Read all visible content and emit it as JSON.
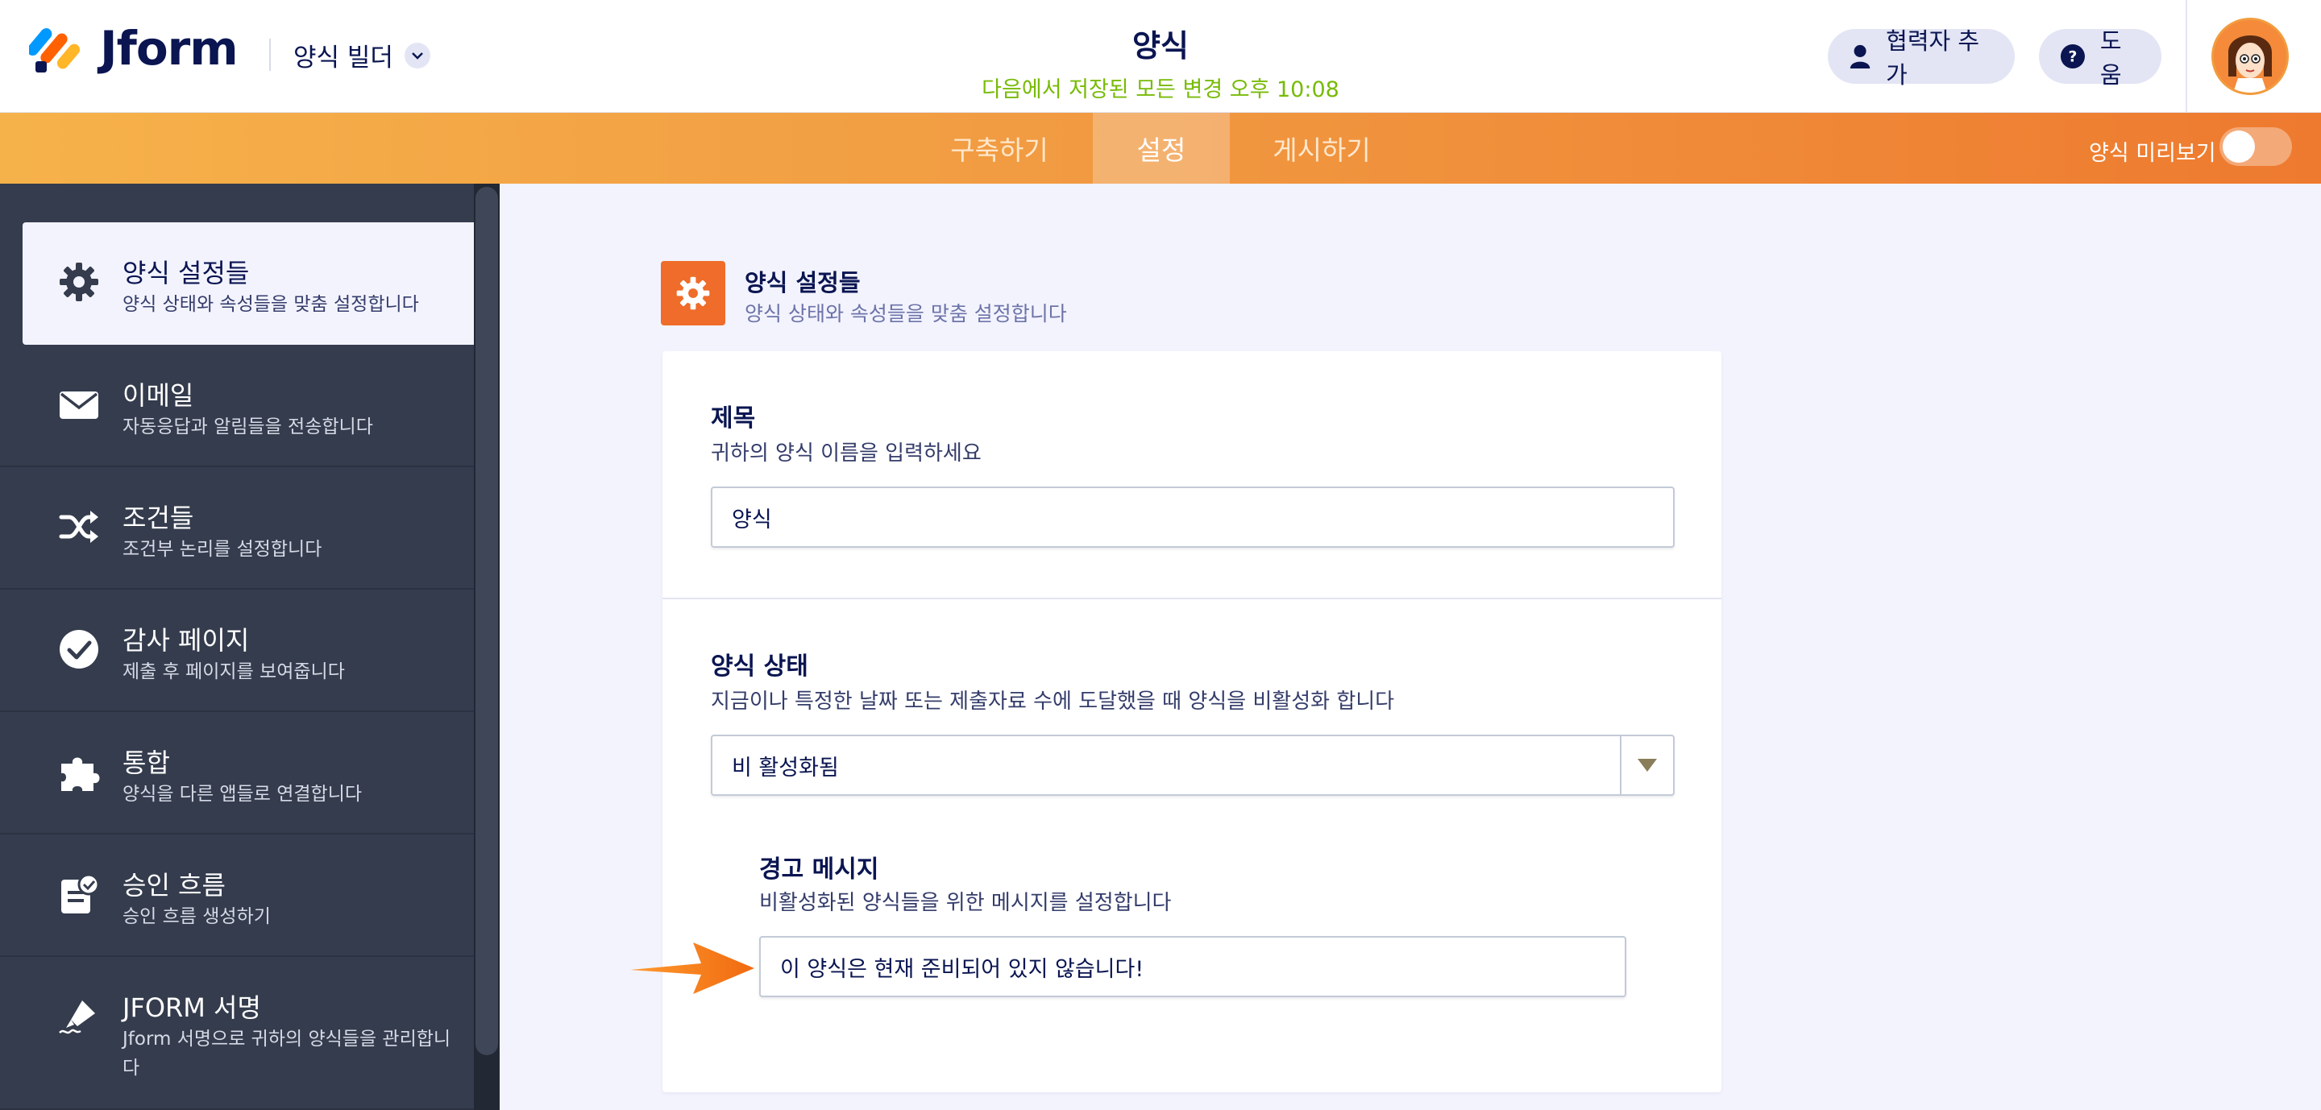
{
  "header": {
    "brand": "Jform",
    "builder_label": "양식 빌더",
    "form_title": "양식",
    "saved_status": "다음에서 저장된 모든 변경 오후 10:08",
    "collab_label": "협력자 추가",
    "help_label": "도움",
    "icons": {
      "collab": "user-icon",
      "help": "question-icon",
      "builder": "chevron-down-icon"
    }
  },
  "nav": {
    "tabs": [
      {
        "label": "구축하기"
      },
      {
        "label": "설정"
      },
      {
        "label": "게시하기"
      }
    ],
    "active_tab": "설정",
    "preview_label": "양식 미리보기",
    "preview_on": false
  },
  "sidebar": {
    "items": [
      {
        "title": "양식 설정들",
        "subtitle": "양식 상태와 속성들을 맞춤 설정합니다",
        "icon": "gear-icon"
      },
      {
        "title": "이메일",
        "subtitle": "자동응답과 알림들을 전송합니다",
        "icon": "envelope-icon"
      },
      {
        "title": "조건들",
        "subtitle": "조건부 논리를 설정합니다",
        "icon": "shuffle-icon"
      },
      {
        "title": "감사 페이지",
        "subtitle": "제출 후 페이지를 보여줍니다",
        "icon": "check-circle-icon"
      },
      {
        "title": "통합",
        "subtitle": "양식을 다른 앱들로 연결합니다",
        "icon": "puzzle-icon"
      },
      {
        "title": "승인 흐름",
        "subtitle": "승인 흐름 생성하기",
        "icon": "clipboard-check-icon"
      },
      {
        "title": "JFORM 서명",
        "subtitle": "Jform 서명으로 귀하의 양식들을 관리합니다",
        "icon": "pen-sign-icon"
      }
    ]
  },
  "main": {
    "section_title": "양식 설정들",
    "section_subtitle": "양식 상태와 속성들을 맞춤 설정합니다",
    "title_field": {
      "label": "제목",
      "help": "귀하의 양식 이름을 입력하세요",
      "value": "양식"
    },
    "status_field": {
      "label": "양식 상태",
      "help": "지금이나 특정한 날짜 또는 제출자료 수에 도달했을 때 양식을 비활성화 합니다",
      "value": "비 활성화됨"
    },
    "warning_field": {
      "label": "경고 메시지",
      "help": "비활성화된 양식들을 위한 메시지를 설정합니다",
      "value": "이 양식은 현재 준비되어 있지 않습니다!"
    }
  },
  "colors": {
    "brand_navy": "#0a1551",
    "accent_orange": "#ef6c2a",
    "saved_green": "#78bb07",
    "sidebar_bg": "#343c4d"
  }
}
